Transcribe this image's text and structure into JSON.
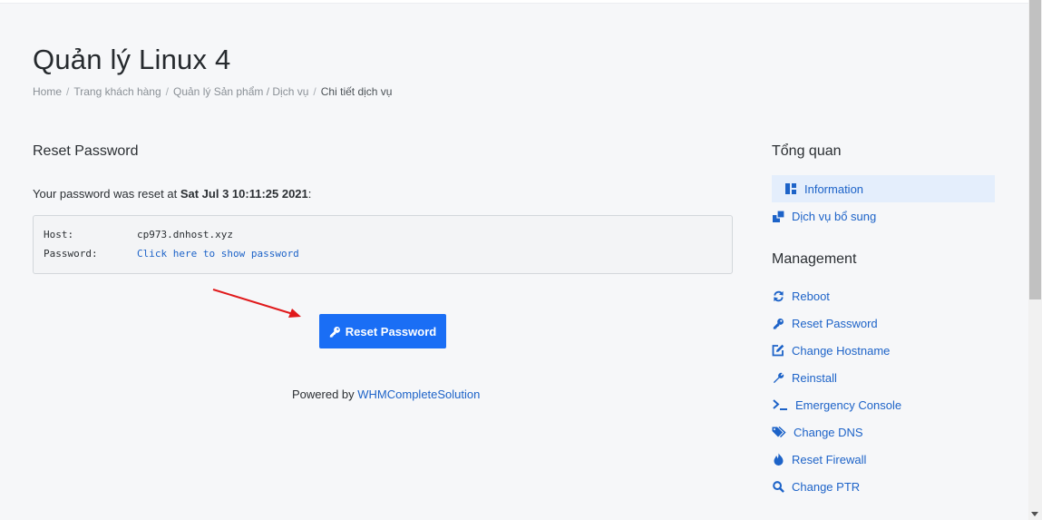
{
  "page": {
    "title": "Quản lý Linux 4",
    "breadcrumb": [
      "Home",
      "Trang khách hàng",
      "Quản lý Sản phẩm / Dịch vụ",
      "Chi tiết dịch vụ"
    ]
  },
  "main": {
    "section_title": "Reset Password",
    "message_prefix": "Your password was reset at ",
    "message_time": "Sat Jul 3 10:11:25 2021",
    "message_suffix": ":",
    "host_label": "Host:",
    "host_value": "cp973.dnhost.xyz",
    "password_label": "Password:",
    "password_link": "Click here to show password",
    "reset_button": "Reset Password",
    "powered_prefix": "Powered by ",
    "powered_link": "WHMCompleteSolution"
  },
  "sidebar": {
    "overview_title": "Tổng quan",
    "overview_items": [
      {
        "label": "Information",
        "icon": "dashboard-icon",
        "active": true
      },
      {
        "label": "Dịch vụ bổ sung",
        "icon": "addons-icon",
        "active": false
      }
    ],
    "management_title": "Management",
    "management_items": [
      {
        "label": "Reboot",
        "icon": "refresh-icon"
      },
      {
        "label": "Reset Password",
        "icon": "key-icon"
      },
      {
        "label": "Change Hostname",
        "icon": "edit-icon"
      },
      {
        "label": "Reinstall",
        "icon": "wrench-icon"
      },
      {
        "label": "Emergency Console",
        "icon": "terminal-icon"
      },
      {
        "label": "Change DNS",
        "icon": "tags-icon"
      },
      {
        "label": "Reset Firewall",
        "icon": "fire-icon"
      },
      {
        "label": "Change PTR",
        "icon": "search-icon"
      }
    ]
  },
  "colors": {
    "accent": "#1a6ef5",
    "link": "#1d63c8",
    "active_bg": "#e4eefc",
    "arrow": "#e0191b"
  }
}
